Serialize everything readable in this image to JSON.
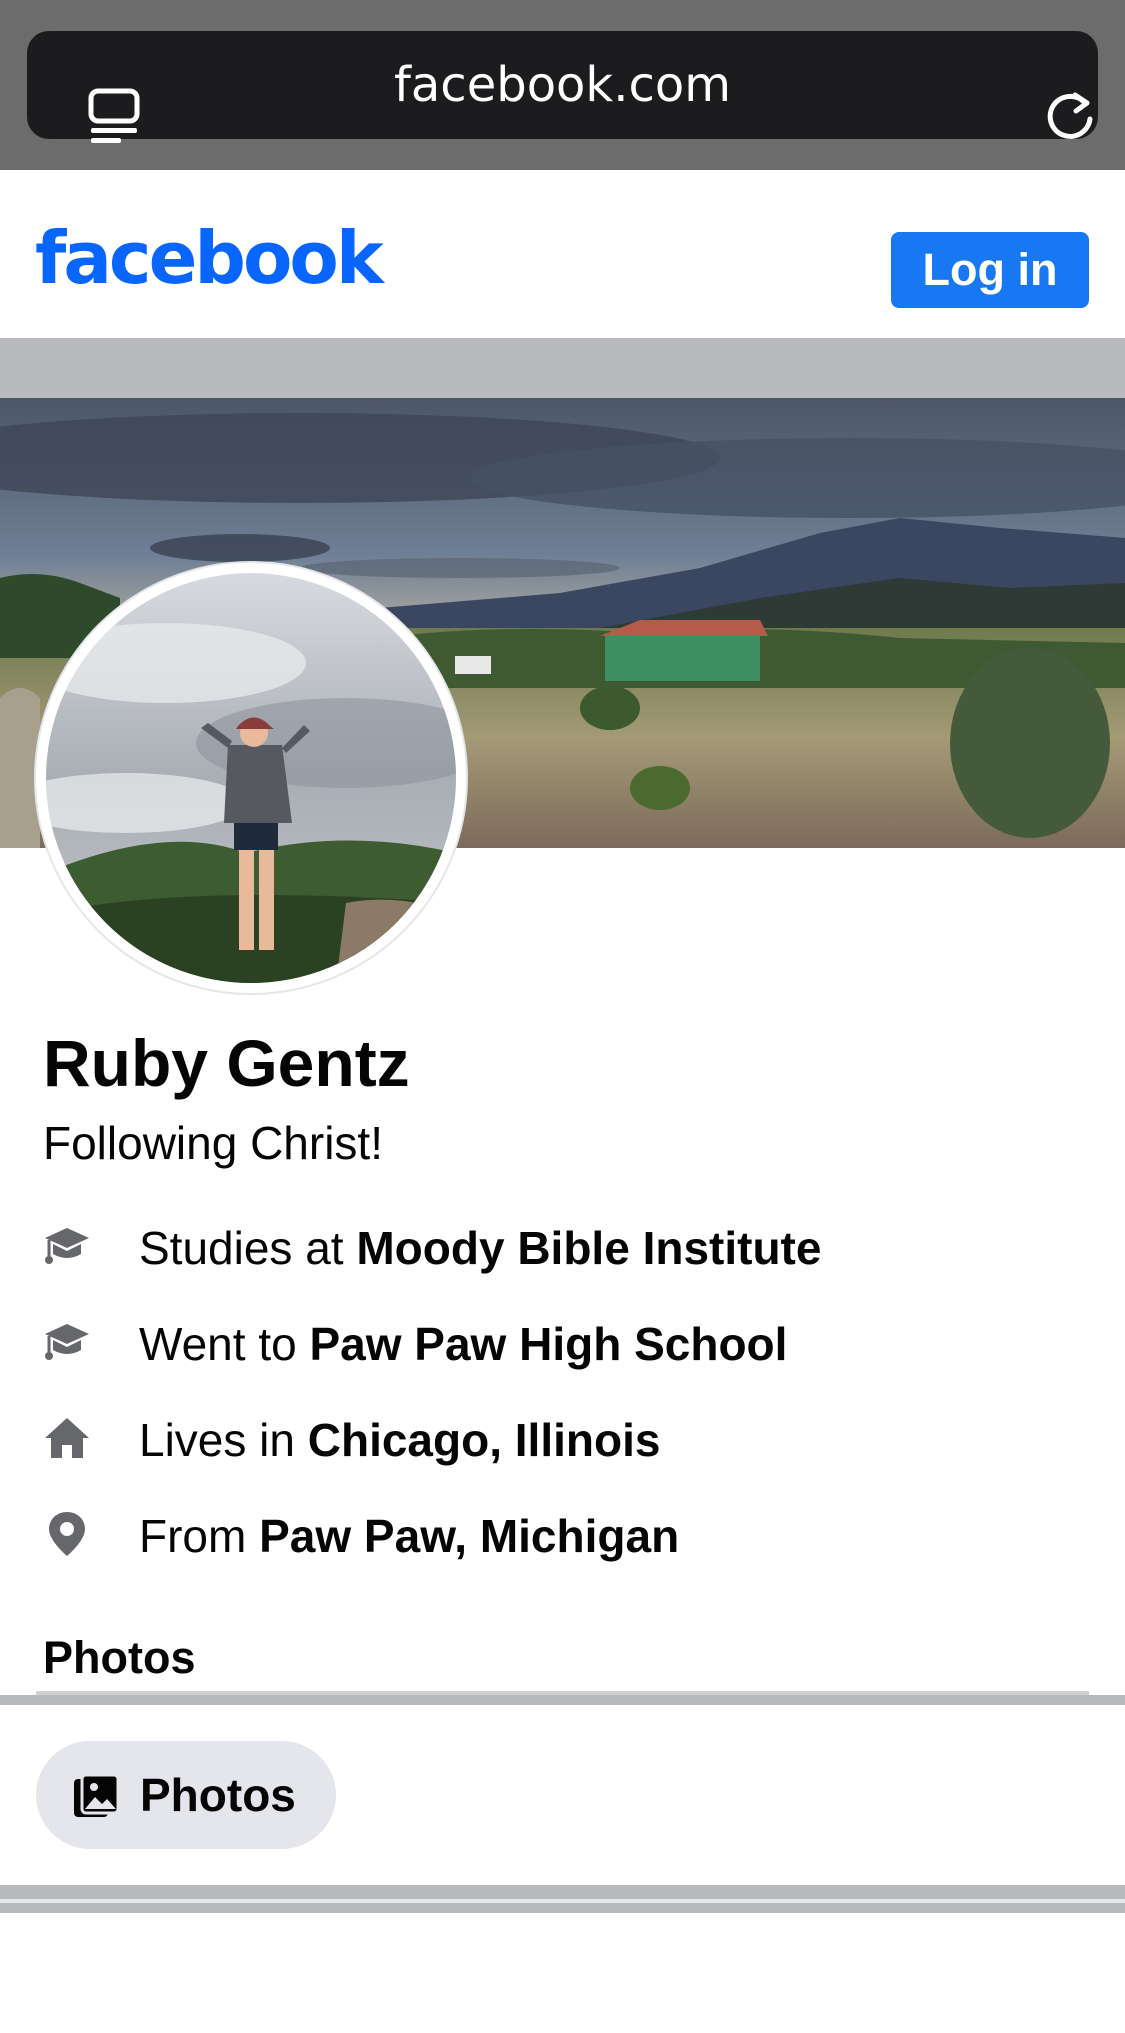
{
  "browser": {
    "url": "facebook.com"
  },
  "header": {
    "logo": "facebook",
    "login_label": "Log in",
    "brand_color": "#0866ff",
    "button_color": "#1877f2"
  },
  "profile": {
    "name": "Ruby Gentz",
    "bio": "Following Christ!",
    "details": [
      {
        "icon": "graduation-cap-icon",
        "prefix": "Studies at ",
        "value": "Moody Bible Institute"
      },
      {
        "icon": "graduation-cap-icon",
        "prefix": "Went to ",
        "value": "Paw Paw High School"
      },
      {
        "icon": "home-icon",
        "prefix": "Lives in ",
        "value": "Chicago, Illinois"
      },
      {
        "icon": "location-pin-icon",
        "prefix": "From ",
        "value": "Paw Paw, Michigan"
      }
    ]
  },
  "photos": {
    "section_title": "Photos",
    "chip_label": "Photos"
  }
}
